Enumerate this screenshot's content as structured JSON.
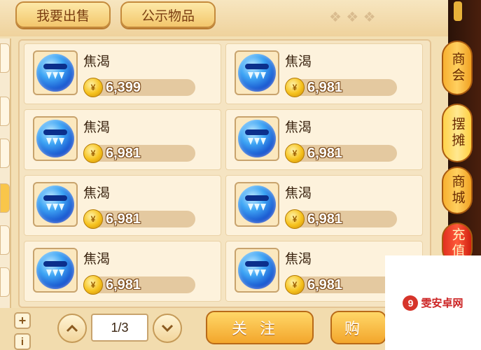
{
  "tabs": {
    "sell": "我要出售",
    "public": "公示物品"
  },
  "items": [
    {
      "name": "焦渴",
      "price": "6,399"
    },
    {
      "name": "焦渴",
      "price": "6,981"
    },
    {
      "name": "焦渴",
      "price": "6,981"
    },
    {
      "name": "焦渴",
      "price": "6,981"
    },
    {
      "name": "焦渴",
      "price": "6,981"
    },
    {
      "name": "焦渴",
      "price": "6,981"
    },
    {
      "name": "焦渴",
      "price": "6,981"
    },
    {
      "name": "焦渴",
      "price": "6,981"
    }
  ],
  "side_menu": {
    "shop": "商会",
    "stall": "摆摊",
    "mall": "商城",
    "charge": "充值"
  },
  "pagination": {
    "page": "1/3"
  },
  "actions": {
    "follow": "关注",
    "buy": "购"
  },
  "bottom_icons": {
    "add": "+",
    "info": "i"
  },
  "watermark": {
    "text": "雯安卓网"
  }
}
